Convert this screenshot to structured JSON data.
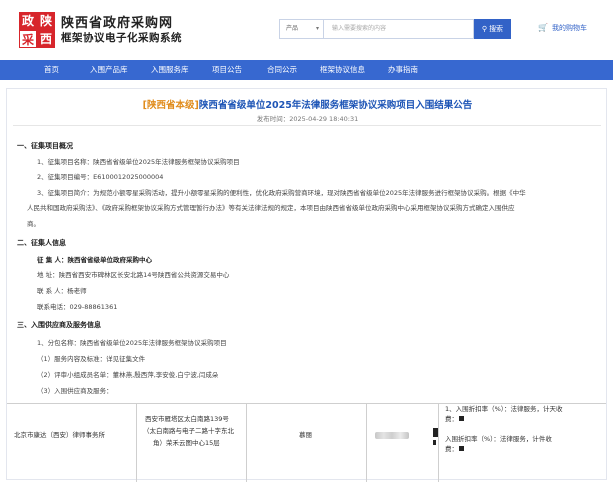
{
  "header": {
    "logo_chars": [
      "政",
      "陕",
      "采",
      "西"
    ],
    "title": "陕西省政府采购网",
    "subtitle": "框架协议电子化采购系统",
    "search": {
      "category": "产品",
      "placeholder": "输入需要搜索的内容",
      "button_label": "搜索"
    },
    "cart_label": "我的购物车"
  },
  "nav": {
    "items": [
      "首页",
      "入围产品库",
      "入围服务库",
      "项目公告",
      "合同公示",
      "框架协议信息",
      "办事指南"
    ]
  },
  "article": {
    "title_tag": "[陕西省本级]",
    "title": "陕西省省级单位2025年法律服务框架协议采购项目入围结果公告",
    "publish_time": "发布时间：2025-04-29 18:40:31",
    "sections": [
      {
        "heading": "一、征集项目概况",
        "lines": [
          "1、征集项目名称：陕西省省级单位2025年法律服务框架协议采购项目",
          "2、征集项目编号：E6100012025000004",
          "3、征集项目简介：为规范小额零星采购活动，提升小额零星采购的便利性，优化政府采购营商环境，现对陕西省省级单位2025年法律服务进行框架协议采购。根据《中华",
          "人民共和国政府采购法》、《政府采购框架协议采购方式管理暂行办法》等有关法律法规的规定，本项目由陕西省省级单位政府采购中心采用框架协议采购方式确定入围供应",
          "商。"
        ]
      },
      {
        "heading": "二、征集人信息",
        "name_label": "征 集 人：",
        "name_value": "陕西省省级单位政府采购中心",
        "lines": [
          "地  址：陕西省西安市碑林区长安北路14号陕西省公共资源交易中心",
          "联 系 人：杨老师",
          "联系电话：029-88861361"
        ]
      },
      {
        "heading": "三、入围供应商及服务信息",
        "lines": [
          "1、分包名称：陕西省省级单位2025年法律服务框架协议采购项目",
          "（1）服务内容及标准：详见征集文件",
          "（2）评审小组成员名单：董林燕,殷西萍,李安俊,白宁波,闫成朵",
          "（3）入围供应商及服务："
        ]
      }
    ],
    "table": {
      "supplier": "北京市康达（西安）律师事务所",
      "address_lines": [
        "西安市雁塔区太白南路139号",
        "（太白南路与电子二路十字东北",
        "角）荣禾云图中心15层"
      ],
      "person": "慕丽",
      "terms_lines": [
        "1、入围折扣率（%）：法律服务，计天收",
        "费：",
        "入围折扣率（%）：法律服务，计件收",
        "费："
      ]
    }
  }
}
